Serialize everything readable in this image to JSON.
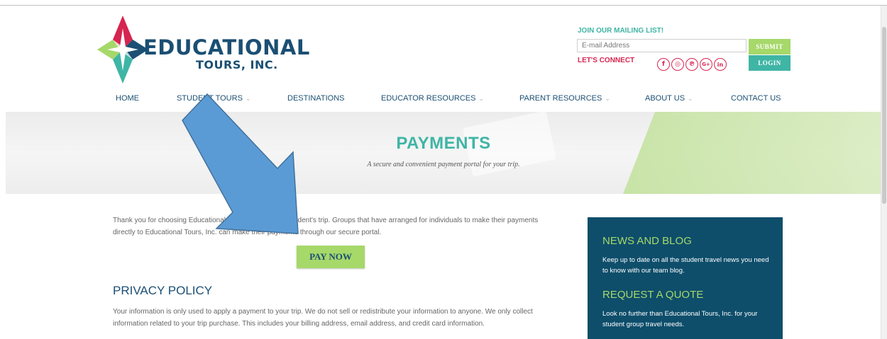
{
  "brand": {
    "name": "EDUCATIONAL",
    "sub": "TOURS, INC.",
    "colors": {
      "navy": "#1b4f73",
      "teal": "#3fb5a5",
      "green": "#a6d86a",
      "red": "#d62550",
      "sidebar": "#0e4e6b"
    }
  },
  "mailing": {
    "label": "JOIN OUR MAILING LIST!",
    "email_placeholder": "E-mail Address",
    "submit_label": "SUBMIT",
    "login_label": "LOGIN",
    "connect_label": "LET'S CONNECT",
    "social": [
      {
        "icon": "facebook-icon",
        "glyph": "f"
      },
      {
        "icon": "instagram-icon",
        "glyph": "◎"
      },
      {
        "icon": "pinterest-icon",
        "glyph": "℗"
      },
      {
        "icon": "google-plus-icon",
        "glyph": "G+"
      },
      {
        "icon": "linkedin-icon",
        "glyph": "in"
      }
    ]
  },
  "nav": {
    "items": [
      {
        "label": "HOME"
      },
      {
        "label": "STUDENT TOURS",
        "dropdown": true
      },
      {
        "label": "DESTINATIONS"
      },
      {
        "label": "EDUCATOR RESOURCES",
        "dropdown": true
      },
      {
        "label": "PARENT RESOURCES",
        "dropdown": true
      },
      {
        "label": "ABOUT US",
        "dropdown": true
      },
      {
        "label": "CONTACT US"
      }
    ]
  },
  "hero": {
    "title": "PAYMENTS",
    "subtitle": "A secure and convenient payment portal for your trip."
  },
  "main": {
    "intro": "Thank you for choosing Educational Tours, Inc. for your student's trip. Groups that have arranged for individuals to make their payments directly to Educational Tours, Inc. can make their payments through our secure portal.",
    "pay_now_label": "PAY NOW",
    "privacy_title": "PRIVACY POLICY",
    "privacy_text": "Your information is only used to apply a payment to your trip. We do not sell or redistribute your information to anyone. We only collect information related to your trip purchase. This includes your billing address, email address, and credit card information."
  },
  "sidebar": {
    "news_title": "NEWS AND BLOG",
    "news_text": "Keep up to date on all the student travel news you need to know with our team blog.",
    "quote_title": "REQUEST A QUOTE",
    "quote_text": "Look no further than Educational Tours, Inc. for your student group travel needs."
  },
  "annotation": {
    "arrow_color": "#5b9bd5",
    "arrow_outline": "#41719c"
  }
}
